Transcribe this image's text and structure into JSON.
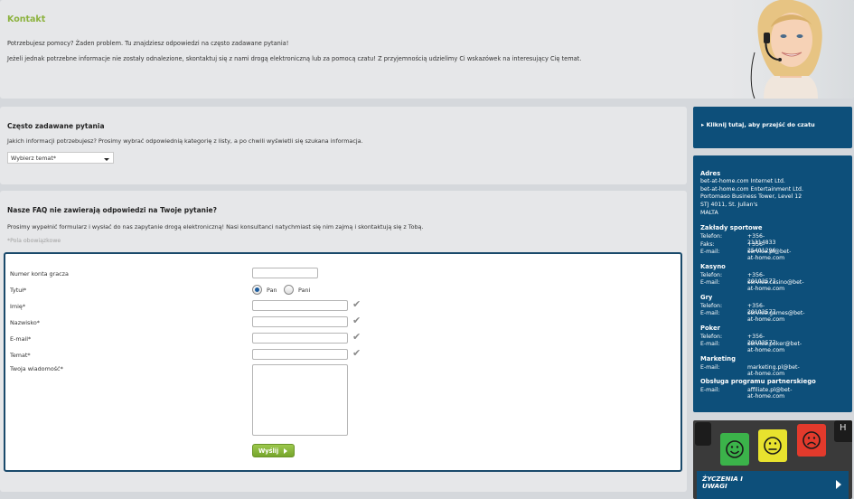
{
  "header": {
    "title": "Kontakt",
    "intro": "Potrzebujesz pomocy? Żaden problem. Tu znajdziesz odpowiedzi na często zadawane pytania!",
    "detail": "Jeżeli jednak potrzebne informacje nie zostały odnalezione, skontaktuj się z nami drogą elektroniczną lub za pomocą czatu! Z przyjemnością udzielimy Ci wskazówek na interesujący Cię temat."
  },
  "faq": {
    "heading": "Często zadawane pytania",
    "description": "Jakich informacji potrzebujesz? Prosimy wybrać odpowiednią kategorię z listy, a po chwili wyświetli się szukana informacja.",
    "select_value": "Wybierz temat*"
  },
  "contact": {
    "heading": "Nasze FAQ nie zawierają odpowiedzi na Twoje pytanie?",
    "description": "Prosimy wypełnić formularz i wysłać do nas zapytanie drogą elektroniczną! Nasi konsultanci natychmiast się nim zajmą i skontaktują się z Tobą.",
    "required_note": "*Pola obowiązkowe",
    "fields": {
      "account": "Numer konta gracza",
      "title": "Tytuł*",
      "first_name": "Imię*",
      "last_name": "Nazwisko*",
      "email": "E-mail*",
      "subject": "Temat*",
      "message": "Twoja wiadomość*"
    },
    "title_options": [
      "Pan",
      "Pani"
    ],
    "selected_title": "Pan",
    "submit_label": "Wyślij"
  },
  "chat": {
    "label": "Kliknij tutaj, aby przejść do czatu"
  },
  "address": {
    "heading": "Adres",
    "lines": [
      "bet-at-home.com Internet Ltd.",
      "bet-at-home.com Entertainment Ltd.",
      "Portomaso Business Tower, Level 12",
      "STJ 4011, St. Julian's",
      "MALTA"
    ],
    "sections": [
      {
        "title": "Zakłady sportowe",
        "rows": [
          [
            "Telefon:",
            "+356-21314833"
          ],
          [
            "Faks:",
            "+356-25401296"
          ],
          [
            "E-mail:",
            "service.pl@bet-at-home.com"
          ]
        ]
      },
      {
        "title": "Kasyno",
        "rows": [
          [
            "Telefon:",
            "+356-20102577"
          ],
          [
            "E-mail:",
            "service.casino@bet-at-home.com"
          ]
        ]
      },
      {
        "title": "Gry",
        "rows": [
          [
            "Telefon:",
            "+356-20102577"
          ],
          [
            "E-mail:",
            "service.games@bet-at-home.com"
          ]
        ]
      },
      {
        "title": "Poker",
        "rows": [
          [
            "Telefon:",
            "+356-20102577"
          ],
          [
            "E-mail:",
            "service.poker@bet-at-home.com"
          ]
        ]
      },
      {
        "title": "Marketing",
        "rows": [
          [
            "E-mail:",
            "marketing.pl@bet-at-home.com"
          ]
        ]
      },
      {
        "title": "Obsługa programu partnerskiego",
        "rows": [
          [
            "E-mail:",
            "affiliate.pl@bet-at-home.com"
          ]
        ]
      }
    ]
  },
  "wishes": {
    "line1": "ŻYCZENIA I",
    "line2": "UWAGI",
    "key_letter": "H"
  },
  "colors": {
    "brand_green": "#8cb23e",
    "brand_blue": "#0d4f7a",
    "form_border": "#1a4a6b"
  }
}
